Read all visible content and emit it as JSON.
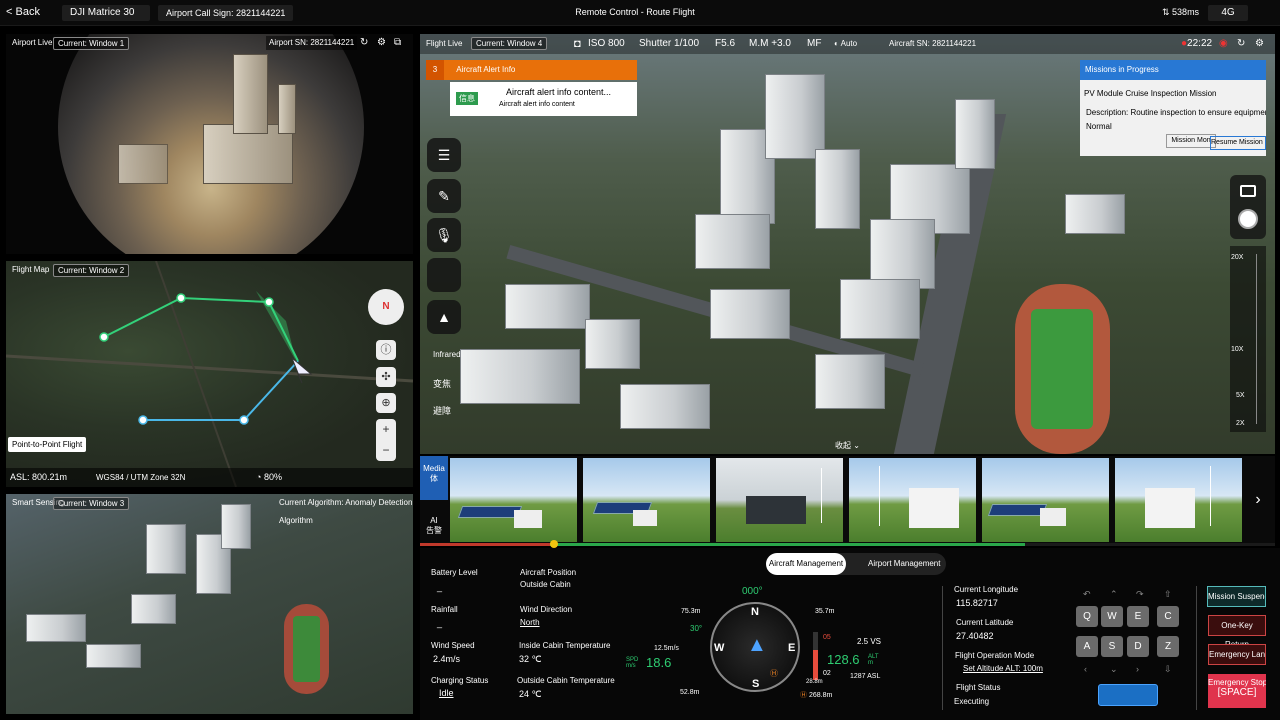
{
  "topbar": {
    "back": "Back",
    "device": "DJI Matrice 30",
    "airport_call_sign": "Airport Call Sign: 2821144221",
    "title": "Remote Control - Route Flight",
    "latency": "538ms",
    "network": "4G"
  },
  "airport_live": {
    "label": "Airport Live",
    "window": "Current: Window 1",
    "sn": "Airport SN: 2821144221"
  },
  "flight_map": {
    "label": "Flight Map",
    "window": "Current: Window 2",
    "mode_button": "Point-to-Point Flight",
    "asl": "ASL:  800.21m",
    "coords": "WGS84 / UTM Zone 32N",
    "progress": "80%",
    "compass": "N"
  },
  "smart_sensing": {
    "label": "Smart Sensing",
    "window": "Current: Window 3",
    "algorithm": "Current Algorithm: Anomaly Detection Algorithm"
  },
  "flight_live": {
    "label": "Flight Live",
    "window": "Current: Window 4",
    "iso": "ISO 800",
    "shutter": "Shutter 1/100",
    "aperture": "F5.6",
    "ev": "M.M +3.0",
    "focus": "MF",
    "wb": "Auto",
    "sn": "Aircraft SN: 2821144221",
    "time": "22:22"
  },
  "alert": {
    "count": "3",
    "title": "Aircraft Alert Info",
    "tag": "信息",
    "content_title": "Aircraft alert info content...",
    "content_body": "Aircraft alert info content"
  },
  "mission": {
    "header": "Missions in Progress",
    "name": "PV Module Cruise Inspection Mission",
    "description": "Description: Routine inspection to ensure equipment op",
    "status": "Normal",
    "btn1": "Mission Mon",
    "btn2": "Resume Mission"
  },
  "left_tools": {
    "infrared": "Infrared",
    "zoom": "变焦",
    "avoid": "避障",
    "collapse": "收起"
  },
  "zoom_scale": {
    "z20": "20X",
    "z10": "10X",
    "z5": "5X",
    "z2": "2X"
  },
  "media": {
    "tab1": "Media",
    "tab1b": "体",
    "tab2": "AI",
    "tab2b": "告警"
  },
  "tabs": {
    "aircraft": "Aircraft Management",
    "airport": "Airport Management"
  },
  "status": {
    "battery_label": "Battery Level",
    "battery_value": "_",
    "rainfall_label": "Rainfall",
    "rainfall_value": "_",
    "wind_speed_label": "Wind Speed",
    "wind_speed_value": "2.4m/s",
    "charging_label": "Charging Status",
    "charging_value": "Idle",
    "position_label": "Aircraft Position",
    "position_value": "Outside Cabin",
    "wind_dir_label": "Wind Direction",
    "wind_dir_value": "North",
    "inside_temp_label": "Inside Cabin Temperature",
    "inside_temp_value": "32 ℃",
    "outside_temp_label": "Outside Cabin Temperature",
    "outside_temp_value": "24 ℃"
  },
  "hud": {
    "heading": "000°",
    "alt_top": "75.3m",
    "pitch": "30°",
    "dist": "35.7m",
    "wind": "12.5m/s",
    "spd_label": "SPD\nm/s",
    "spd": "18.6",
    "vs": "2.5 VS",
    "alt": "128.6",
    "alt_label": "ALT\nm",
    "asl": "1287 ASL",
    "bottom_left": "52.8m",
    "home": "268.8m",
    "tick05": "05",
    "tick02": "02",
    "tick288": "28.8m",
    "n": "N",
    "e": "E",
    "s": "S",
    "w": "W"
  },
  "nav": {
    "lon_label": "Current Longitude",
    "lon": "115.82717",
    "lat_label": "Current Latitude",
    "lat": "27.40482",
    "mode_label": "Flight Operation Mode",
    "mode": "Set Altitude ALT: 100m",
    "flight_status_label": "Flight Status",
    "flight_status": "Executing"
  },
  "keys": {
    "q": "Q",
    "w": "W",
    "e": "E",
    "c": "C",
    "a": "A",
    "s": "S",
    "d": "D",
    "z": "Z"
  },
  "actions": {
    "suspend": "Mission Suspended",
    "return": "One-Key Return",
    "land": "Emergency Landing",
    "stop": "Emergency Stop",
    "stop_key": "[SPACE]"
  }
}
